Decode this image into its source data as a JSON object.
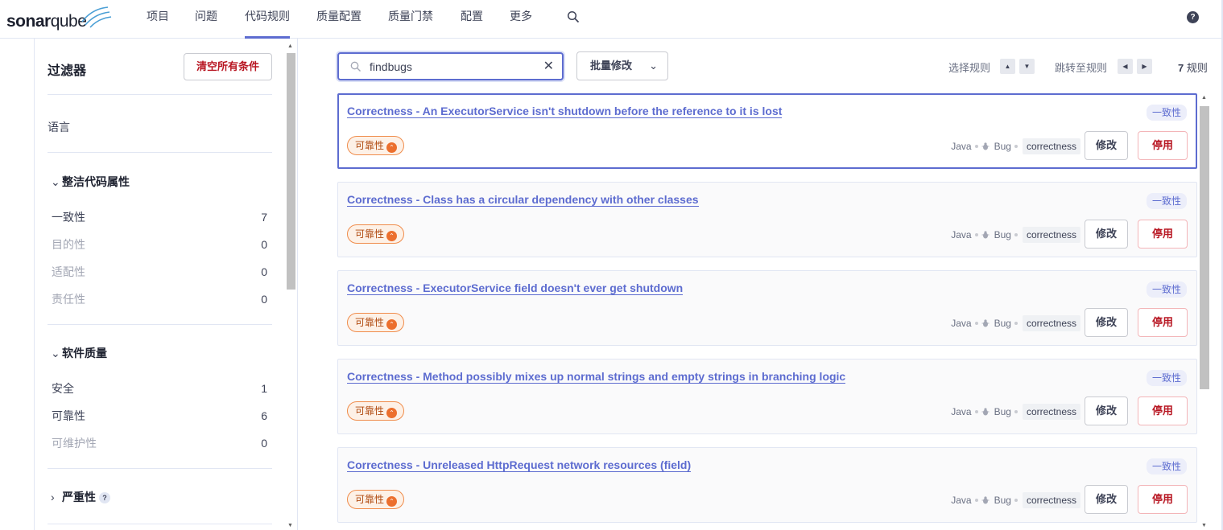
{
  "nav": {
    "logo_bold": "sonar",
    "logo_light": "qube",
    "items": [
      "项目",
      "问题",
      "代码规则",
      "质量配置",
      "质量门禁",
      "配置",
      "更多"
    ],
    "active_index": 2,
    "help_label": "?"
  },
  "sidebar": {
    "title": "过滤器",
    "clear_button": "清空所有条件",
    "language_label": "语言",
    "clean_code": {
      "heading": "整洁代码属性",
      "items": [
        {
          "label": "一致性",
          "count": "7",
          "dim": false
        },
        {
          "label": "目的性",
          "count": "0",
          "dim": true
        },
        {
          "label": "适配性",
          "count": "0",
          "dim": true
        },
        {
          "label": "责任性",
          "count": "0",
          "dim": true
        }
      ]
    },
    "software_quality": {
      "heading": "软件质量",
      "items": [
        {
          "label": "安全",
          "count": "1",
          "dim": false
        },
        {
          "label": "可靠性",
          "count": "6",
          "dim": false
        },
        {
          "label": "可维护性",
          "count": "0",
          "dim": true
        }
      ]
    },
    "severity": {
      "heading": "严重性",
      "help": "?"
    }
  },
  "toolbar": {
    "search_value": "findbugs",
    "search_clear": "✕",
    "bulk_label": "批量修改",
    "select_rule_label": "选择规则",
    "jump_rule_label": "跳转至规则",
    "count_number": "7",
    "count_suffix": " 规则"
  },
  "rules": [
    {
      "title": "Correctness - An ExecutorService isn't shutdown before the reference to it is lost",
      "attribute": "一致性",
      "impact": "可靠性",
      "language": "Java",
      "type": "Bug",
      "tag": "correctness",
      "edit": "修改",
      "deactivate": "停用",
      "selected": true
    },
    {
      "title": "Correctness - Class has a circular dependency with other classes",
      "attribute": "一致性",
      "impact": "可靠性",
      "language": "Java",
      "type": "Bug",
      "tag": "correctness",
      "edit": "修改",
      "deactivate": "停用",
      "selected": false
    },
    {
      "title": "Correctness - ExecutorService field doesn't ever get shutdown",
      "attribute": "一致性",
      "impact": "可靠性",
      "language": "Java",
      "type": "Bug",
      "tag": "correctness",
      "edit": "修改",
      "deactivate": "停用",
      "selected": false
    },
    {
      "title": "Correctness - Method possibly mixes up normal strings and empty strings in branching logic",
      "attribute": "一致性",
      "impact": "可靠性",
      "language": "Java",
      "type": "Bug",
      "tag": "correctness",
      "edit": "修改",
      "deactivate": "停用",
      "selected": false
    },
    {
      "title": "Correctness - Unreleased HttpRequest network resources (field)",
      "attribute": "一致性",
      "impact": "可靠性",
      "language": "Java",
      "type": "Bug",
      "tag": "correctness",
      "edit": "修改",
      "deactivate": "停用",
      "selected": false
    }
  ],
  "colors": {
    "accent": "#5d6cd0",
    "danger": "#b81723",
    "impact_orange": "#ec6f2d"
  }
}
